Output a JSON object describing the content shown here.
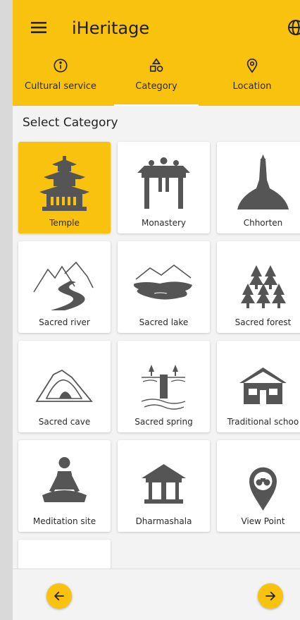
{
  "app": {
    "title": "iHeritage"
  },
  "icons": {
    "menu": "menu-icon",
    "language": "globe-icon"
  },
  "tabs": [
    {
      "label": "Cultural service",
      "icon": "info-icon"
    },
    {
      "label": "Category",
      "icon": "shapes-icon",
      "active": true
    },
    {
      "label": "Location",
      "icon": "location-pin-icon"
    }
  ],
  "section_title": "Select Category",
  "categories": [
    {
      "label": "Temple",
      "icon": "temple-icon",
      "selected": true
    },
    {
      "label": "Monastery",
      "icon": "monastery-gate-icon"
    },
    {
      "label": "Chhorten",
      "icon": "chhorten-stupa-icon"
    },
    {
      "label": "Sacred river",
      "icon": "river-icon"
    },
    {
      "label": "Sacred lake",
      "icon": "lake-icon"
    },
    {
      "label": "Sacred forest",
      "icon": "forest-icon"
    },
    {
      "label": "Sacred cave",
      "icon": "cave-icon"
    },
    {
      "label": "Sacred spring",
      "icon": "spring-icon"
    },
    {
      "label": "Traditional schoo",
      "icon": "school-icon"
    },
    {
      "label": "Meditation site",
      "icon": "meditation-icon"
    },
    {
      "label": "Dharmashala",
      "icon": "dharmashala-icon"
    },
    {
      "label": "View Point",
      "icon": "view-point-icon"
    },
    {
      "label": "",
      "icon": "partial-icon"
    }
  ],
  "nav": {
    "back": "arrow-left-icon",
    "forward": "arrow-right-icon"
  },
  "colors": {
    "accent": "#f8c20f",
    "icon_gray": "#545454"
  }
}
